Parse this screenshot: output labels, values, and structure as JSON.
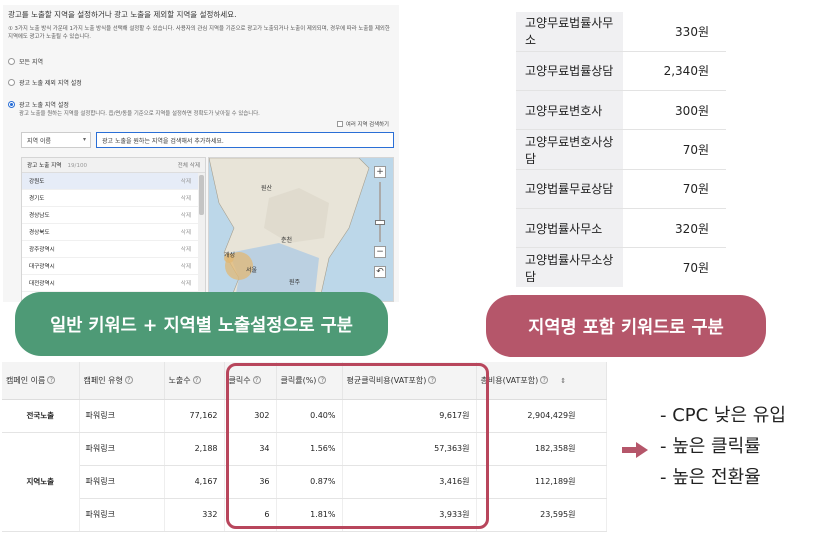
{
  "settings": {
    "title": "광고를 노출할 지역을 설정하거나 광고 노출을 제외할 지역을 설정하세요.",
    "note": "① 3가지 노출 방식 가운데 1가지 노출 방식을 선택해 설정할 수 있습니다. 사용자의 관심 지역을 기준으로 광고가 노출되거나 노출이 제외되며, 경우에 따라 노출을 제외한 지역에도 광고가 노출될 수 있습니다.",
    "options": [
      "모든 지역",
      "광고 노출 제외 지역 설정",
      "광고 노출 지역 설정"
    ],
    "selected_option_sub": "광고 노출을 원하는 지역을 설정합니다. 읍/면/동을 기준으로 지역을 설정하면 정확도가 낮아질 수 있습니다.",
    "multi_search_label": "여러 지역 검색하기",
    "region_select": "지역 이름",
    "region_input_placeholder": "광고 노출을 원하는 지역을 검색해서 추가하세요.",
    "list_title": "광고 노출 지역",
    "list_count": "19/100",
    "delete_all": "전체 삭제",
    "delete_label": "삭제",
    "regions": [
      "강원도",
      "경기도",
      "경상남도",
      "경상북도",
      "광주광역시",
      "대구광역시",
      "대전광역시"
    ],
    "map_labels": [
      "원산",
      "춘천",
      "개성",
      "서울",
      "원주"
    ]
  },
  "pill_left": "일반 키워드 + 지역별 노출설정으로 구분",
  "pill_right": "지역명 포함 키워드로 구분",
  "keywords": [
    {
      "name": "고양무료법률사무소",
      "value": "330원"
    },
    {
      "name": "고양무료법률상담",
      "value": "2,340원"
    },
    {
      "name": "고양무료변호사",
      "value": "300원"
    },
    {
      "name": "고양무료변호사상담",
      "value": "70원"
    },
    {
      "name": "고양법률무료상담",
      "value": "70원"
    },
    {
      "name": "고양법률사무소",
      "value": "320원"
    },
    {
      "name": "고양법률사무소상담",
      "value": "70원"
    }
  ],
  "campaign_table": {
    "headers": [
      "캠페인 이름",
      "캠페인 유형",
      "노출수",
      "클릭수",
      "클릭률(%)",
      "평균클릭비용(VAT포함)",
      "총비용(VAT포함)"
    ],
    "group1": "전국노출",
    "group2": "지역노출",
    "rows": [
      {
        "type": "파워링크",
        "impressions": "77,162",
        "clicks": "302",
        "ctr": "0.40%",
        "cpc": "9,617원",
        "cost": "2,904,429원"
      },
      {
        "type": "파워링크",
        "impressions": "2,188",
        "clicks": "34",
        "ctr": "1.56%",
        "cpc": "57,363원",
        "cost": "182,358원"
      },
      {
        "type": "파워링크",
        "impressions": "4,167",
        "clicks": "36",
        "ctr": "0.87%",
        "cpc": "3,416원",
        "cost": "112,189원"
      },
      {
        "type": "파워링크",
        "impressions": "332",
        "clicks": "6",
        "ctr": "1.81%",
        "cpc": "3,933원",
        "cost": "23,595원"
      }
    ]
  },
  "bullets": [
    "- CPC 낮은 유입",
    "- 높은 클릭률",
    "- 높은 전환율"
  ],
  "colors": {
    "green": "#4e9a76",
    "rose": "#b5566a",
    "highlight": "#b8465c",
    "accent": "#2a6fd6"
  }
}
